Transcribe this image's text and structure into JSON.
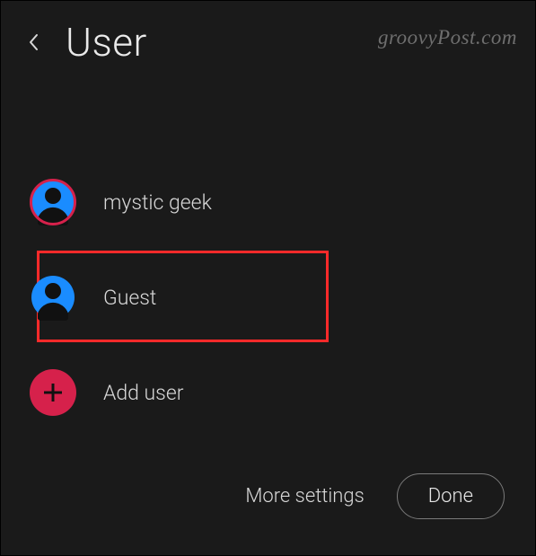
{
  "header": {
    "title": "User"
  },
  "watermark": "groovyPost.com",
  "users": {
    "current": {
      "label": "mystic geek"
    },
    "guest": {
      "label": "Guest"
    },
    "add": {
      "label": "Add user"
    }
  },
  "footer": {
    "more_settings": "More settings",
    "done": "Done"
  },
  "colors": {
    "accent_blue": "#1a8cff",
    "accent_red": "#d6214b",
    "highlight": "#ff2a2a"
  }
}
